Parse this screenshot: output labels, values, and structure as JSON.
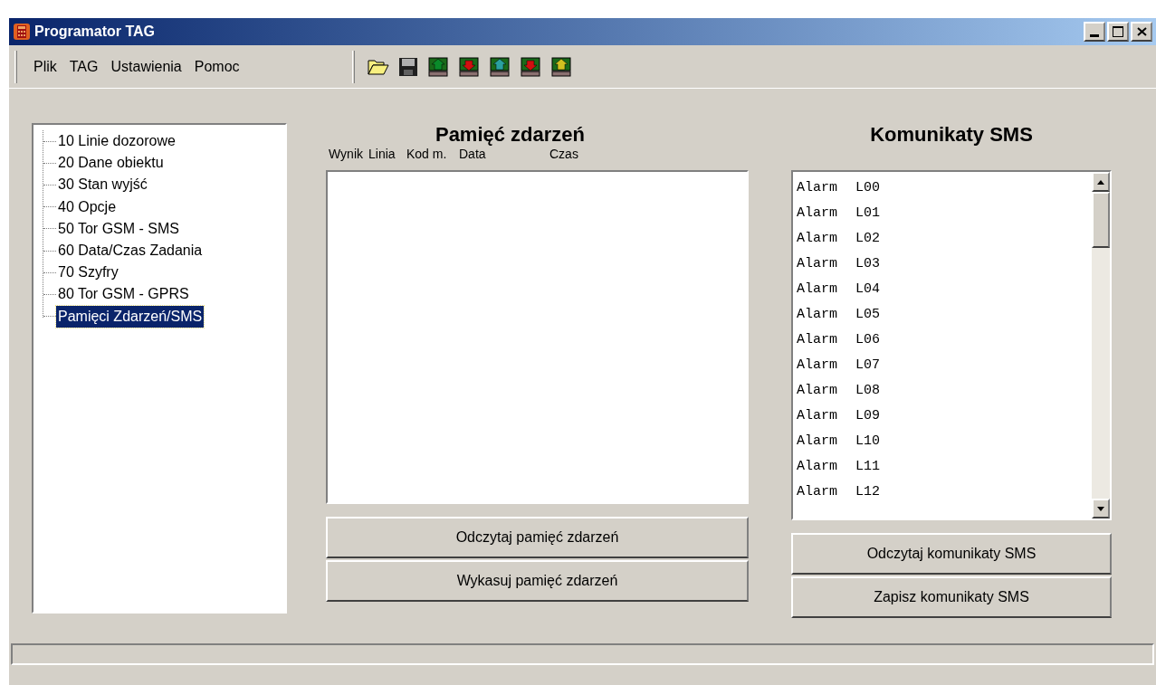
{
  "window": {
    "title": "Programator TAG"
  },
  "menu": [
    "Plik",
    "TAG",
    "Ustawienia",
    "Pomoc"
  ],
  "tree": {
    "items": [
      {
        "label": "10 Linie dozorowe",
        "selected": false
      },
      {
        "label": "20 Dane obiektu",
        "selected": false
      },
      {
        "label": "30 Stan wyjść",
        "selected": false
      },
      {
        "label": "40 Opcje",
        "selected": false
      },
      {
        "label": "50 Tor GSM - SMS",
        "selected": false
      },
      {
        "label": "60 Data/Czas Zadania",
        "selected": false
      },
      {
        "label": "70 Szyfry",
        "selected": false
      },
      {
        "label": "80 Tor GSM - GPRS",
        "selected": false
      },
      {
        "label": "Pamięci Zdarzeń/SMS",
        "selected": true
      }
    ]
  },
  "events": {
    "title": "Pamięć zdarzeń",
    "columns": [
      "Wynik",
      "Linia",
      "Kod m.",
      "Data",
      "Czas"
    ],
    "buttons": [
      "Odczytaj pamięć zdarzeń",
      "Wykasuj pamięć zdarzeń"
    ]
  },
  "sms": {
    "title": "Komunikaty SMS",
    "rows": [
      [
        "Alarm",
        "L00"
      ],
      [
        "Alarm",
        "L01"
      ],
      [
        "Alarm",
        "L02"
      ],
      [
        "Alarm",
        "L03"
      ],
      [
        "Alarm",
        "L04"
      ],
      [
        "Alarm",
        "L05"
      ],
      [
        "Alarm",
        "L06"
      ],
      [
        "Alarm",
        "L07"
      ],
      [
        "Alarm",
        "L08"
      ],
      [
        "Alarm",
        "L09"
      ],
      [
        "Alarm",
        "L10"
      ],
      [
        "Alarm",
        "L11"
      ],
      [
        "Alarm",
        "L12"
      ]
    ],
    "buttons": [
      "Odczytaj komunikaty SMS",
      "Zapisz komunikaty SMS"
    ]
  }
}
